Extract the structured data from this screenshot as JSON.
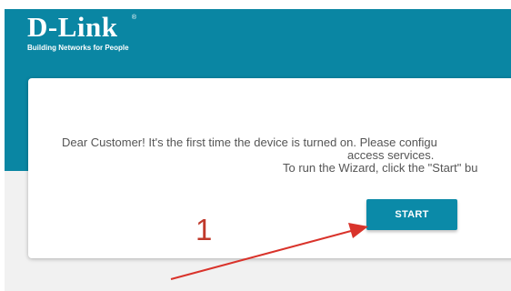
{
  "brand": {
    "name": "D-Link",
    "trademark": "®",
    "tagline": "Building Networks for People"
  },
  "welcome": {
    "line1": "Dear Customer! It's the first time the device is turned on. Please configu",
    "line2": "access services.",
    "line3": "To run the Wizard, click the \"Start\" bu"
  },
  "actions": {
    "start_label": "START"
  },
  "annotation": {
    "label": "1",
    "color": "#c0392b"
  },
  "colors": {
    "header": "#0a86a3",
    "button": "#0b8aa8",
    "background": "#f1f1f1"
  }
}
